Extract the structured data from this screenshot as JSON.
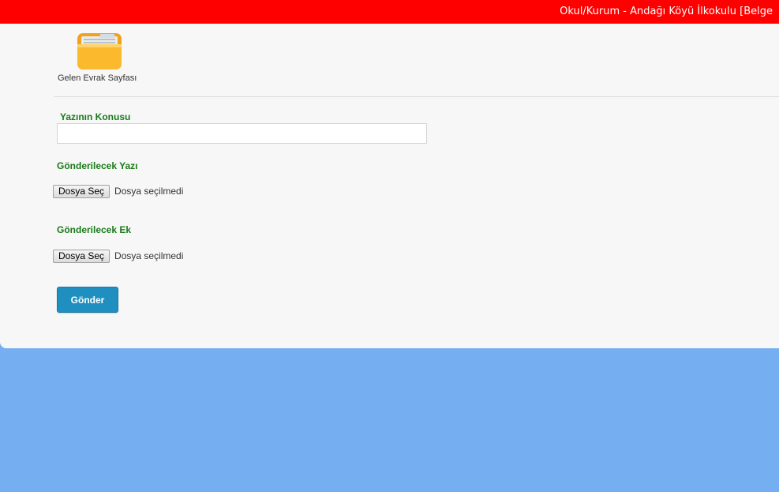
{
  "header": {
    "title": "Okul/Kurum - Andağı Köyü İlkokulu [Belge"
  },
  "nav": {
    "page_icon": "folder-icon",
    "page_label": "Gelen Evrak Sayfası"
  },
  "form": {
    "subject_label": "Yazının Konusu",
    "subject_value": "",
    "document_label": "Gönderilecek Yazı",
    "document_button": "Dosya Seç",
    "document_status": "Dosya seçilmedi",
    "attachment_label": "Gönderilecek Ek",
    "attachment_button": "Dosya Seç",
    "attachment_status": "Dosya seçilmedi",
    "submit_label": "Gönder"
  },
  "colors": {
    "header_bg": "#ff0000",
    "background": "#76aef2",
    "label_green": "#1a7a1a",
    "submit_blue": "#1f8fc0"
  }
}
